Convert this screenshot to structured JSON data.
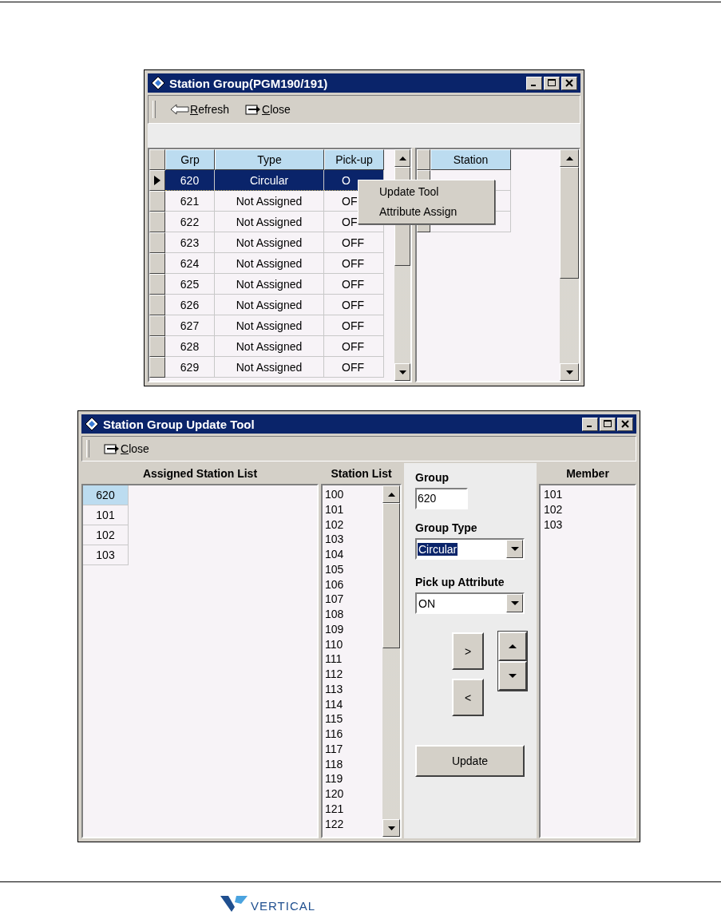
{
  "station_group_window": {
    "title": "Station Group(PGM190/191)",
    "toolbar": [
      {
        "label": "Refresh",
        "kind": "refresh"
      },
      {
        "label": "Close",
        "kind": "close"
      }
    ],
    "group_table": {
      "columns": [
        "Grp",
        "Type",
        "Pick-up"
      ],
      "rows": [
        {
          "grp": "620",
          "type": "Circular",
          "pickup": "O",
          "selected": true
        },
        {
          "grp": "621",
          "type": "Not Assigned",
          "pickup": "OF",
          "selected": false
        },
        {
          "grp": "622",
          "type": "Not Assigned",
          "pickup": "OF",
          "selected": false
        },
        {
          "grp": "623",
          "type": "Not Assigned",
          "pickup": "OFF",
          "selected": false
        },
        {
          "grp": "624",
          "type": "Not Assigned",
          "pickup": "OFF",
          "selected": false
        },
        {
          "grp": "625",
          "type": "Not Assigned",
          "pickup": "OFF",
          "selected": false
        },
        {
          "grp": "626",
          "type": "Not Assigned",
          "pickup": "OFF",
          "selected": false
        },
        {
          "grp": "627",
          "type": "Not Assigned",
          "pickup": "OFF",
          "selected": false
        },
        {
          "grp": "628",
          "type": "Not Assigned",
          "pickup": "OFF",
          "selected": false
        },
        {
          "grp": "629",
          "type": "Not Assigned",
          "pickup": "OFF",
          "selected": false
        }
      ]
    },
    "station_table": {
      "column": "Station"
    },
    "context_menu": [
      "Update Tool",
      "Attribute Assign"
    ]
  },
  "update_tool_window": {
    "title": "Station Group Update Tool",
    "toolbar": [
      {
        "label": "Close",
        "kind": "close"
      }
    ],
    "assigned_station_list": {
      "header": "Assigned Station List",
      "items": [
        {
          "value": "620",
          "selected": true
        },
        {
          "value": "101",
          "selected": false
        },
        {
          "value": "102",
          "selected": false
        },
        {
          "value": "103",
          "selected": false
        }
      ]
    },
    "station_list": {
      "header": "Station List",
      "items": [
        "100",
        "101",
        "102",
        "103",
        "104",
        "105",
        "106",
        "107",
        "108",
        "109",
        "110",
        "111",
        "112",
        "113",
        "114",
        "115",
        "116",
        "117",
        "118",
        "119",
        "120",
        "121",
        "122"
      ]
    },
    "group": {
      "label": "Group",
      "value": "620"
    },
    "group_type": {
      "label": "Group Type",
      "value": "Circular",
      "highlighted": true
    },
    "pickup_attribute": {
      "label": "Pick up Attribute",
      "value": "ON",
      "highlighted": false
    },
    "add_button": ">",
    "remove_button": "<",
    "update_button": "Update",
    "member": {
      "header": "Member",
      "items": [
        "101",
        "102",
        "103"
      ]
    }
  },
  "footer": {
    "logo": "VERTICAL"
  }
}
